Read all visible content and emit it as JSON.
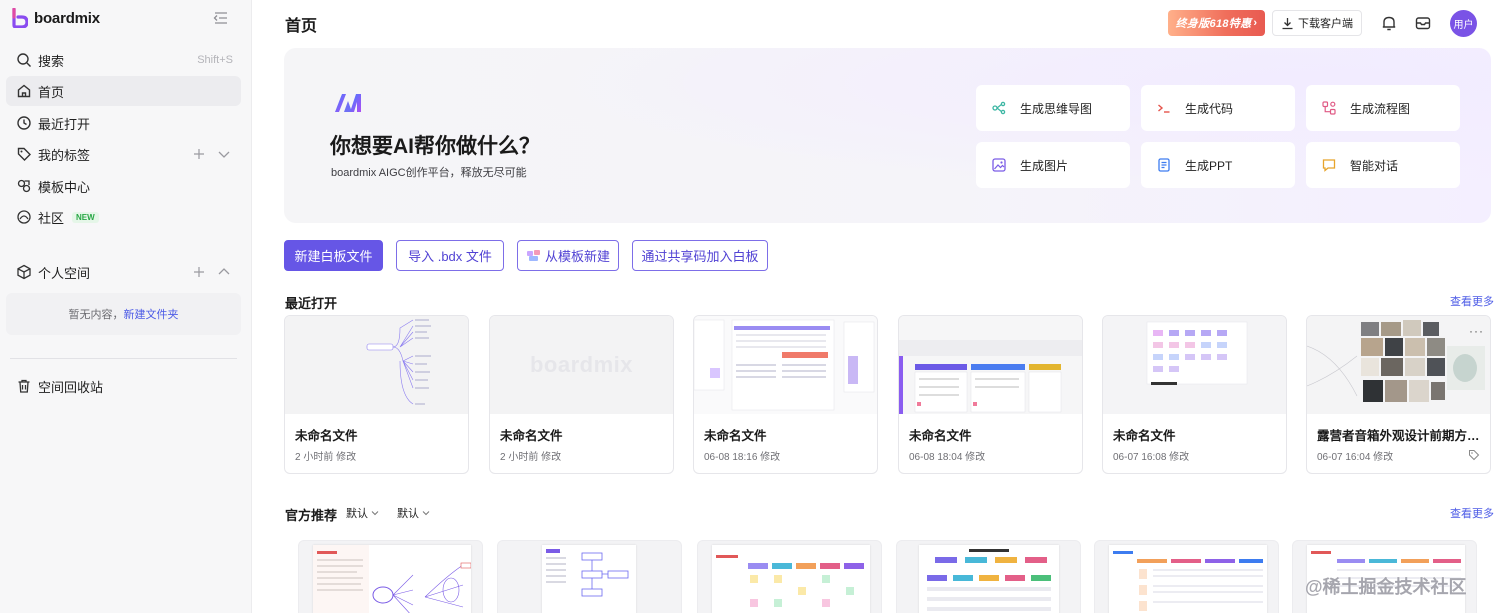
{
  "app": {
    "name": "boardmix"
  },
  "sidebar": {
    "search": {
      "label": "搜索",
      "shortcut": "Shift+S"
    },
    "items": [
      {
        "label": "首页"
      },
      {
        "label": "最近打开"
      },
      {
        "label": "我的标签"
      },
      {
        "label": "模板中心"
      },
      {
        "label": "社区",
        "badge": "NEW"
      }
    ],
    "personal_space": {
      "label": "个人空间",
      "empty_text": "暂无内容，",
      "empty_link": "新建文件夹"
    },
    "trash": {
      "label": "空间回收站"
    }
  },
  "header": {
    "title": "首页",
    "promo": "终身版618特惠",
    "download": "下载客户端",
    "avatar": "用户"
  },
  "hero": {
    "title": "你想要AI帮你做什么？",
    "subtitle": "boardmix AIGC创作平台，释放无尽可能",
    "cards": [
      {
        "label": "生成思维导图",
        "icon": "mindmap-icon"
      },
      {
        "label": "生成代码",
        "icon": "code-icon"
      },
      {
        "label": "生成流程图",
        "icon": "flowchart-icon"
      },
      {
        "label": "生成图片",
        "icon": "image-icon"
      },
      {
        "label": "生成PPT",
        "icon": "ppt-icon"
      },
      {
        "label": "智能对话",
        "icon": "chat-icon"
      }
    ]
  },
  "actions": {
    "new_board": "新建白板文件",
    "import": "导入 .bdx 文件",
    "from_template": "从模板新建",
    "join_code": "通过共享码加入白板"
  },
  "recent": {
    "title": "最近打开",
    "see_more": "查看更多",
    "files": [
      {
        "name": "未命名文件",
        "meta": "2 小时前 修改"
      },
      {
        "name": "未命名文件",
        "meta": "2 小时前 修改"
      },
      {
        "name": "未命名文件",
        "meta": "06-08 18:16 修改"
      },
      {
        "name": "未命名文件",
        "meta": "06-08 18:04 修改"
      },
      {
        "name": "未命名文件",
        "meta": "06-07 16:08 修改"
      },
      {
        "name": "露营者音箱外观设计前期方…",
        "meta": "06-07 16:04 修改"
      }
    ],
    "thumb_watermark": "boardmix"
  },
  "official": {
    "title": "官方推荐",
    "filter1": "默认",
    "filter2": "默认",
    "see_more": "查看更多"
  },
  "watermark": "@稀土掘金技术社区",
  "colors": {
    "accent": "#6656e6",
    "link": "#4c5be6",
    "avatar": "#7a53e6"
  }
}
